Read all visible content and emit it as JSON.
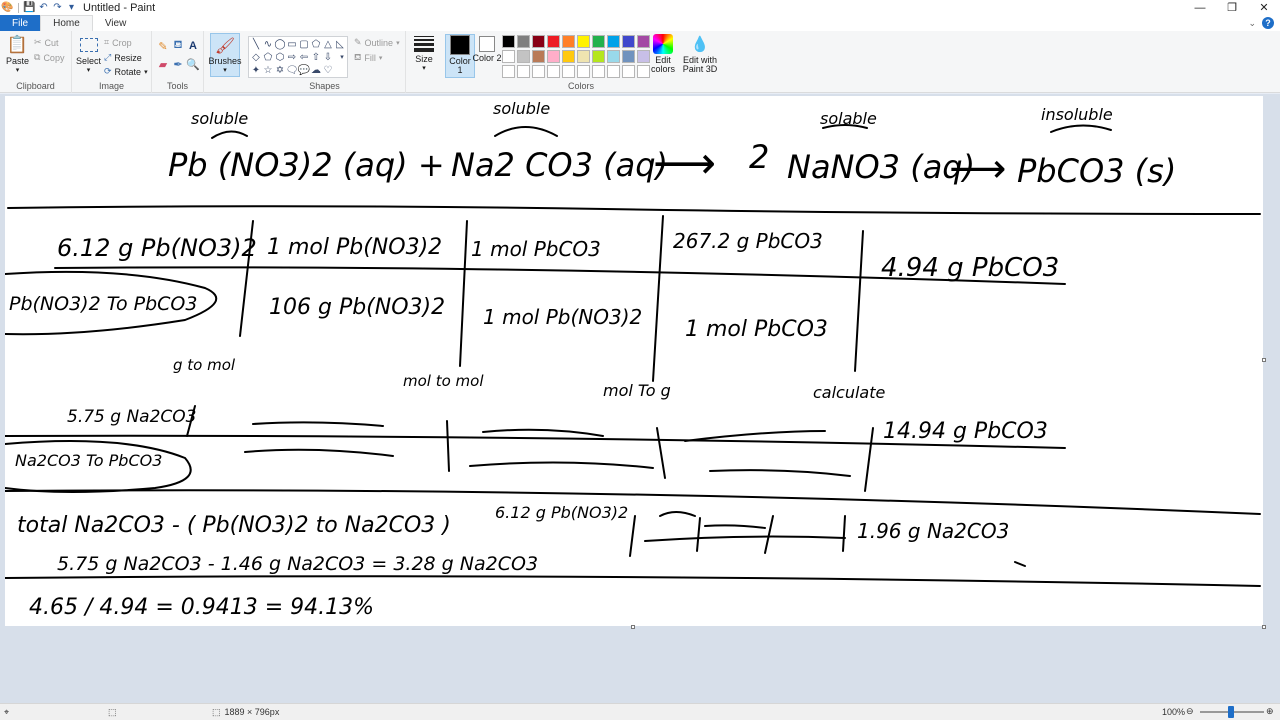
{
  "app": {
    "title": "Untitled - Paint"
  },
  "tabs": [
    {
      "label": "File"
    },
    {
      "label": "Home"
    },
    {
      "label": "View"
    }
  ],
  "ribbon": {
    "clipboard": {
      "label": "Clipboard",
      "paste": "Paste",
      "cut": "Cut",
      "copy": "Copy"
    },
    "image": {
      "label": "Image",
      "select": "Select",
      "crop": "Crop",
      "resize": "Resize",
      "rotate": "Rotate"
    },
    "tools": {
      "label": "Tools"
    },
    "brushes": {
      "label": "Brushes"
    },
    "shapes": {
      "label": "Shapes",
      "outline": "Outline",
      "fill": "Fill"
    },
    "size": {
      "label": "Size"
    },
    "colors": {
      "label": "Colors",
      "color1": "Color 1",
      "color2": "Color 2",
      "color1_value": "#000000",
      "color2_value": "#ffffff",
      "edit_colors": "Edit colors",
      "paint3d": "Edit with Paint 3D",
      "palette": [
        "#000000",
        "#7f7f7f",
        "#880015",
        "#ed1c24",
        "#ff7f27",
        "#fff200",
        "#22b14c",
        "#00a2e8",
        "#3f48cc",
        "#a349a4",
        "#ffffff",
        "#c3c3c3",
        "#b97a57",
        "#ffaec9",
        "#ffc90e",
        "#efe4b0",
        "#b5e61d",
        "#99d9ea",
        "#7092be",
        "#c8bfe7",
        "#ffffff",
        "#ffffff",
        "#ffffff",
        "#ffffff",
        "#ffffff",
        "#ffffff",
        "#ffffff",
        "#ffffff",
        "#ffffff",
        "#ffffff"
      ]
    }
  },
  "canvas": {
    "ink": {
      "eq_soluble1": "soluble",
      "eq_soluble2": "soluble",
      "eq_soluble3": "solable",
      "eq_insoluble": "insoluble",
      "eq_pb": "Pb (NO3)2 (aq) +",
      "eq_na": "Na2 CO3 (aq)",
      "eq_arrow1": "⟶",
      "eq_2": "2",
      "eq_nano3": "NaNO3 (aq)",
      "eq_arrow2": "⟶",
      "eq_pbco3": "PbCO3 (s)",
      "r1c1": "6.12 g Pb(NO3)2",
      "r1c2": "1 mol Pb(NO3)2",
      "r1c3": "1 mol PbCO3",
      "r1c4": "267.2 g PbCO3",
      "r1c5": "4.94 g PbCO3",
      "r1lbl": "Pb(NO3)2 To PbCO3",
      "r2c2": "106 g Pb(NO3)2",
      "r2c3": "1 mol Pb(NO3)2",
      "r2c4": "1 mol PbCO3",
      "n1": "g to mol",
      "n2": "mol to mol",
      "n3": "mol To g",
      "n4": "calculate",
      "r3c1": "5.75 g Na2CO3",
      "r3c5": "14.94 g PbCO3",
      "r3lbl": "Na2CO3 To PbCO3",
      "r4a": "total Na2CO3 - ( Pb(NO3)2 to Na2CO3 )",
      "r4b": "6.12 g Pb(NO3)2",
      "r4c": "1.96 g Na2CO3",
      "r5": "5.75 g Na2CO3 - 1.46 g Na2CO3 = 3.28 g Na2CO3",
      "r6": "4.65 / 4.94   = 0.9413  = 94.13%"
    }
  },
  "status": {
    "dimensions": "1889 × 796px",
    "zoom": "100%",
    "zoom_value": 100
  }
}
